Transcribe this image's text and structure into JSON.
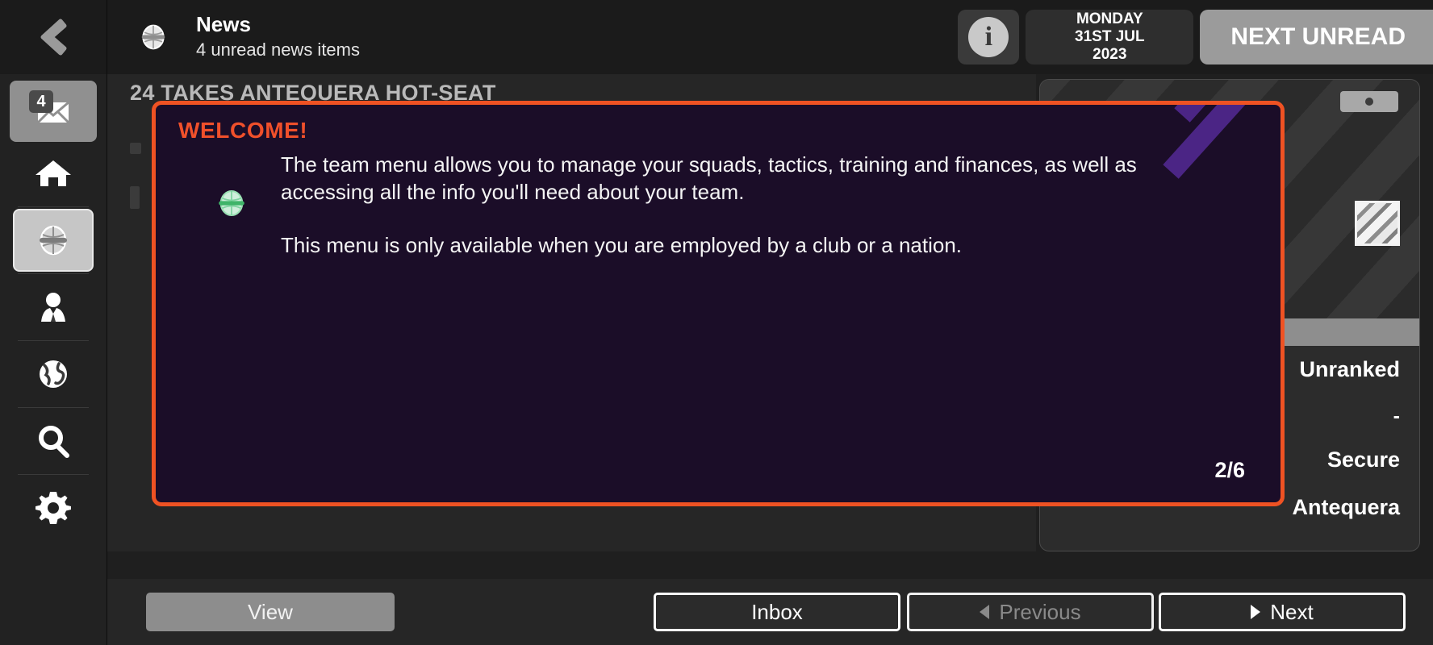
{
  "window": {
    "back_icon": "chevron-left-icon"
  },
  "sidebar": {
    "items": [
      {
        "id": "inbox",
        "icon": "envelope-icon",
        "badge": "4",
        "selected": true
      },
      {
        "id": "home",
        "icon": "home-icon",
        "badge": "",
        "selected": false
      },
      {
        "id": "team",
        "icon": "shirt-icon",
        "badge": "",
        "selected": true
      },
      {
        "id": "staff",
        "icon": "person-tie-icon",
        "badge": "",
        "selected": false
      },
      {
        "id": "world",
        "icon": "globe-icon",
        "badge": "",
        "selected": false
      },
      {
        "id": "search",
        "icon": "magnifier-icon",
        "badge": "",
        "selected": false
      },
      {
        "id": "settings",
        "icon": "gear-icon",
        "badge": "",
        "selected": false
      }
    ]
  },
  "header": {
    "icon": "shirt-icon",
    "title": "News",
    "subtitle": "4 unread news items",
    "info_label": "i",
    "date": {
      "weekday": "MONDAY",
      "day": "31ST JUL",
      "year": "2023"
    },
    "next_unread_label": "NEXT UNREAD"
  },
  "article": {
    "headline": "24 TAKES ANTEQUERA HOT-SEAT"
  },
  "side_panel": {
    "lines": [
      "Unranked",
      "-",
      "Secure",
      "Antequera"
    ]
  },
  "tutorial": {
    "title": "WELCOME!",
    "icon": "shirt-icon-green",
    "paragraph_1": "The team menu allows you to manage your squads, tactics, training and finances, as well as accessing all the info you'll need about your team.",
    "paragraph_2": "This menu is only available when you are employed by a club or a nation.",
    "counter": "2/6",
    "border_color": "#ef5223",
    "background_color": "#1b0d28",
    "title_color": "#f0502b"
  },
  "toolbar": {
    "view_label": "View",
    "inbox_label": "Inbox",
    "previous_label": "Previous",
    "next_label": "Next"
  }
}
